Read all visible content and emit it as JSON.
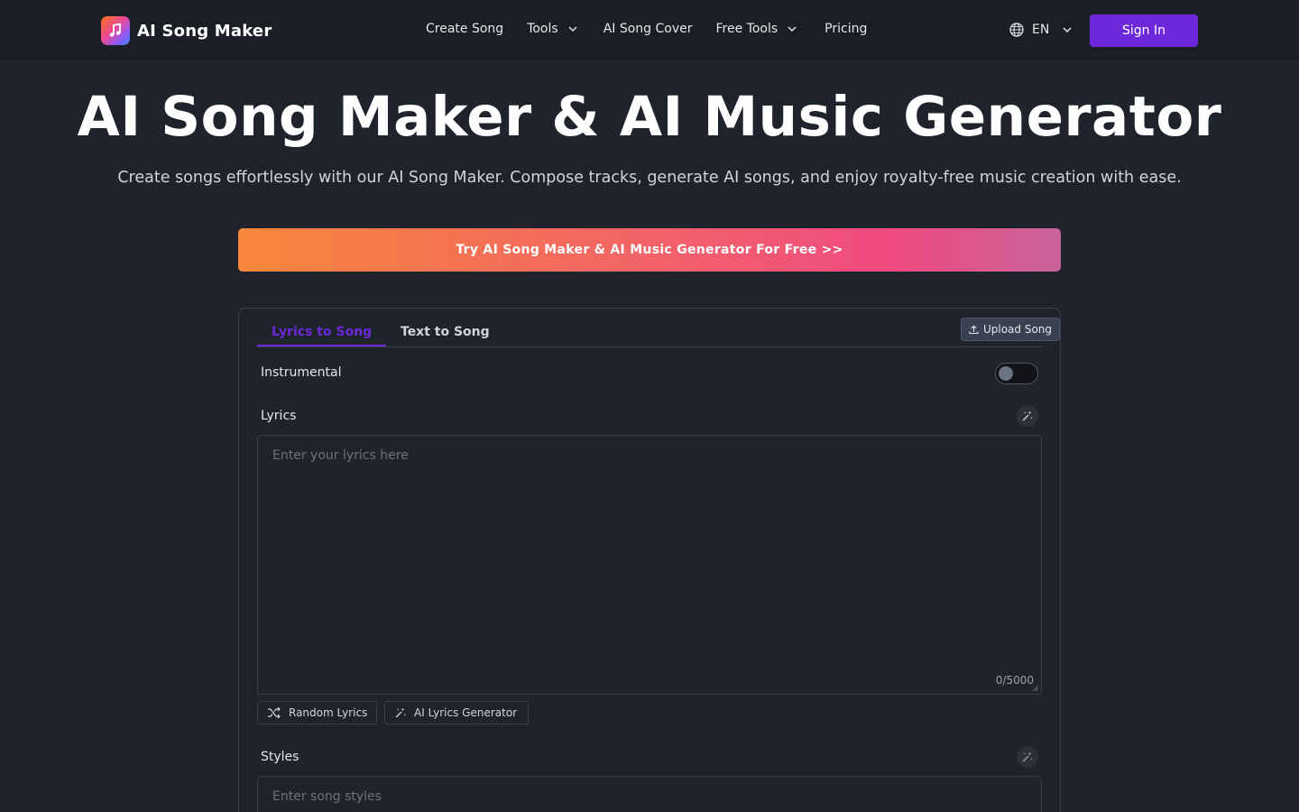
{
  "header": {
    "brand": "AI Song Maker",
    "nav": [
      {
        "label": "Create Song",
        "dropdown": false
      },
      {
        "label": "Tools",
        "dropdown": true
      },
      {
        "label": "AI Song Cover",
        "dropdown": false
      },
      {
        "label": "Free Tools",
        "dropdown": true
      },
      {
        "label": "Pricing",
        "dropdown": false
      }
    ],
    "language": "EN",
    "sign_in": "Sign In"
  },
  "hero": {
    "title": "AI Song Maker & AI Music Generator",
    "subtitle": "Create songs effortlessly with our AI Song Maker. Compose tracks, generate AI songs, and enjoy royalty-free music creation with ease.",
    "cta": "Try AI Song Maker & AI Music Generator For Free >>"
  },
  "form": {
    "tabs": [
      "Lyrics to Song",
      "Text to Song"
    ],
    "active_tab": "Lyrics to Song",
    "upload_label": "Upload Song",
    "instrumental_label": "Instrumental",
    "instrumental_on": false,
    "lyrics_label": "Lyrics",
    "lyrics_placeholder": "Enter your lyrics here",
    "lyrics_counter": "0/5000",
    "random_lyrics": "Random Lyrics",
    "ai_lyrics_generator": "AI Lyrics Generator",
    "styles_label": "Styles",
    "styles_placeholder": "Enter song styles"
  },
  "colors": {
    "accent": "#6d28d9",
    "background": "#1f232b",
    "header_bg": "#1b1e25",
    "cta_gradient_start": "#f5873a",
    "cta_gradient_end": "#c8649a"
  }
}
